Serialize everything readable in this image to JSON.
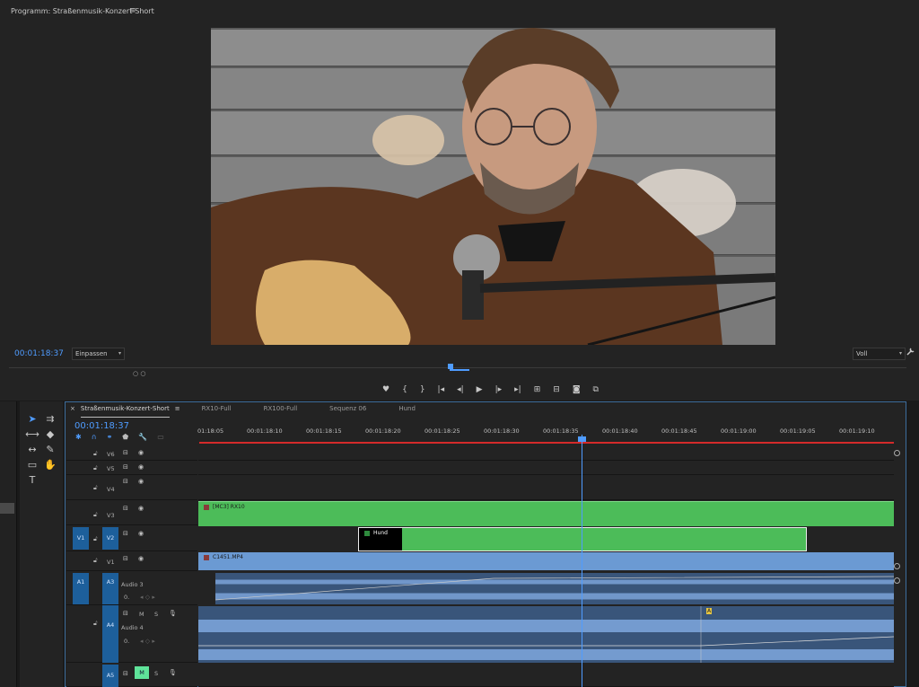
{
  "program": {
    "title": "Programm: Straßenmusik-Konzert-Short",
    "menu_icon": "≡",
    "timecode": "00:01:18:37",
    "fit": "Einpassen",
    "quality": "Voll",
    "wrench": "🔧",
    "zoom_handles": "○ ○"
  },
  "transport": {
    "marker": "♥",
    "mark_in": "{",
    "mark_out": "}",
    "go_in": "|◂",
    "step_back": "◂|",
    "play": "▶",
    "step_fwd": "|▸",
    "go_out": "▸|",
    "lift": "⊞",
    "extract": "⊟",
    "camera": "◙",
    "compare": "⧉"
  },
  "timeline": {
    "tabs": [
      {
        "label": "Straßenmusik-Konzert-Short",
        "active": true,
        "menu": "≡"
      },
      {
        "label": "RX10-Full"
      },
      {
        "label": "RX100-Full"
      },
      {
        "label": "Sequenz 06"
      },
      {
        "label": "Hund"
      }
    ],
    "close_icon": "×",
    "timecode": "00:01:18:37",
    "ruler_labels": [
      "01:18:05",
      "00:01:18:10",
      "00:01:18:15",
      "00:01:18:20",
      "00:01:18:25",
      "00:01:18:30",
      "00:01:18:35",
      "00:01:18:40",
      "00:01:18:45",
      "00:01:19:00",
      "00:01:19:05",
      "00:01:19:10"
    ],
    "tracks": {
      "v6": "V6",
      "v5": "V5",
      "v4": "V4",
      "v3": "V3",
      "v2": "V2",
      "v1": "V1",
      "src_v1": "V1",
      "src_a1": "A1",
      "a3": "A3",
      "a3_name": "Audio 3",
      "a4": "A4",
      "a4_name": "Audio 4",
      "a5": "A5",
      "m": "M",
      "s": "S",
      "zero": "0."
    },
    "clips": {
      "v3": "[MC3] RX10",
      "v2": "Hund",
      "v1": "C1451.MP4",
      "marker_a4": "A"
    }
  },
  "tools": [
    "selection",
    "track-select",
    "ripple",
    "razor",
    "slip",
    "pen",
    "rectangle",
    "hand",
    "type"
  ],
  "colors": {
    "accent": "#4f9cff",
    "video_clip": "#4cbc59",
    "v1_clip": "#6b9ad3",
    "audio_clip": "#39557a",
    "playhead_bar": "#d52a2a"
  }
}
